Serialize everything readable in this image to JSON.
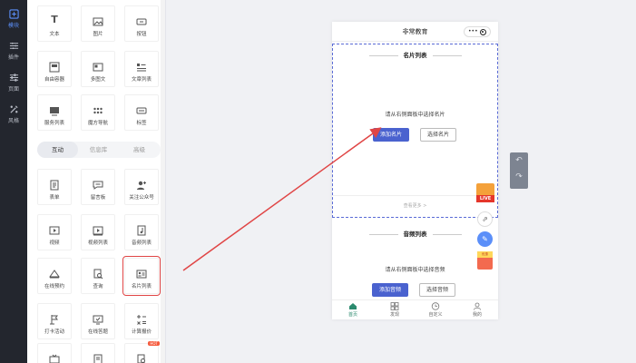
{
  "rail": {
    "items": [
      {
        "label": "模块",
        "icon": "plus-box-icon"
      },
      {
        "label": "插件",
        "icon": "grid-icon"
      },
      {
        "label": "页面",
        "icon": "sliders-icon"
      },
      {
        "label": "风格",
        "icon": "brush-icon"
      }
    ]
  },
  "panel": {
    "basic_items": [
      {
        "label": "文本",
        "icon": "text-icon"
      },
      {
        "label": "图片",
        "icon": "image-icon"
      },
      {
        "label": "按钮",
        "icon": "button-icon"
      },
      {
        "label": "自由容器",
        "icon": "container-icon"
      },
      {
        "label": "多图文",
        "icon": "multi-image-text-icon"
      },
      {
        "label": "文章列表",
        "icon": "article-list-icon"
      },
      {
        "label": "服务列表",
        "icon": "service-list-icon"
      },
      {
        "label": "魔方导航",
        "icon": "cube-nav-icon"
      },
      {
        "label": "标签",
        "icon": "tag-icon"
      }
    ],
    "tabs": [
      "互动",
      "信息库",
      "高级"
    ],
    "active_tab": "互动",
    "interactive_items": [
      {
        "label": "表单",
        "icon": "form-icon"
      },
      {
        "label": "留言板",
        "icon": "message-board-icon"
      },
      {
        "label": "关注公众号",
        "icon": "follow-account-icon"
      },
      {
        "label": "视频",
        "icon": "video-icon"
      },
      {
        "label": "视频列表",
        "icon": "video-list-icon"
      },
      {
        "label": "音频列表",
        "icon": "audio-list-icon"
      },
      {
        "label": "在线预约",
        "icon": "reservation-icon"
      },
      {
        "label": "查询",
        "icon": "query-icon"
      },
      {
        "label": "名片列表",
        "icon": "card-list-icon"
      },
      {
        "label": "打卡活动",
        "icon": "checkin-icon"
      },
      {
        "label": "在线答题",
        "icon": "quiz-icon"
      },
      {
        "label": "计算报价",
        "icon": "calculator-icon"
      }
    ],
    "selected_item": "名片列表",
    "badge": "HOT"
  },
  "phone": {
    "title": "非常教育",
    "capsule_dots": "•••",
    "card_section": {
      "heading": "名片列表",
      "hint": "请从右侧面板中选择名片",
      "add_button": "添加名片",
      "select_button": "选择名片",
      "more": "查看更多 >"
    },
    "audio_section": {
      "heading": "音频列表",
      "hint": "请从右侧面板中选择音频",
      "add_button": "添加音频",
      "select_button": "选择音频"
    },
    "tabbar": [
      {
        "label": "首页",
        "icon": "home-icon"
      },
      {
        "label": "发现",
        "icon": "discover-icon"
      },
      {
        "label": "自定义",
        "icon": "clock-icon"
      },
      {
        "label": "我的",
        "icon": "user-icon"
      }
    ]
  },
  "floating": {
    "live_label": "LIVE",
    "gift_label": "优惠"
  },
  "colors": {
    "accent": "#4a62cf",
    "highlight": "#e04545",
    "rail_bg": "#23262e",
    "tab_active": "#2b8a6e"
  }
}
